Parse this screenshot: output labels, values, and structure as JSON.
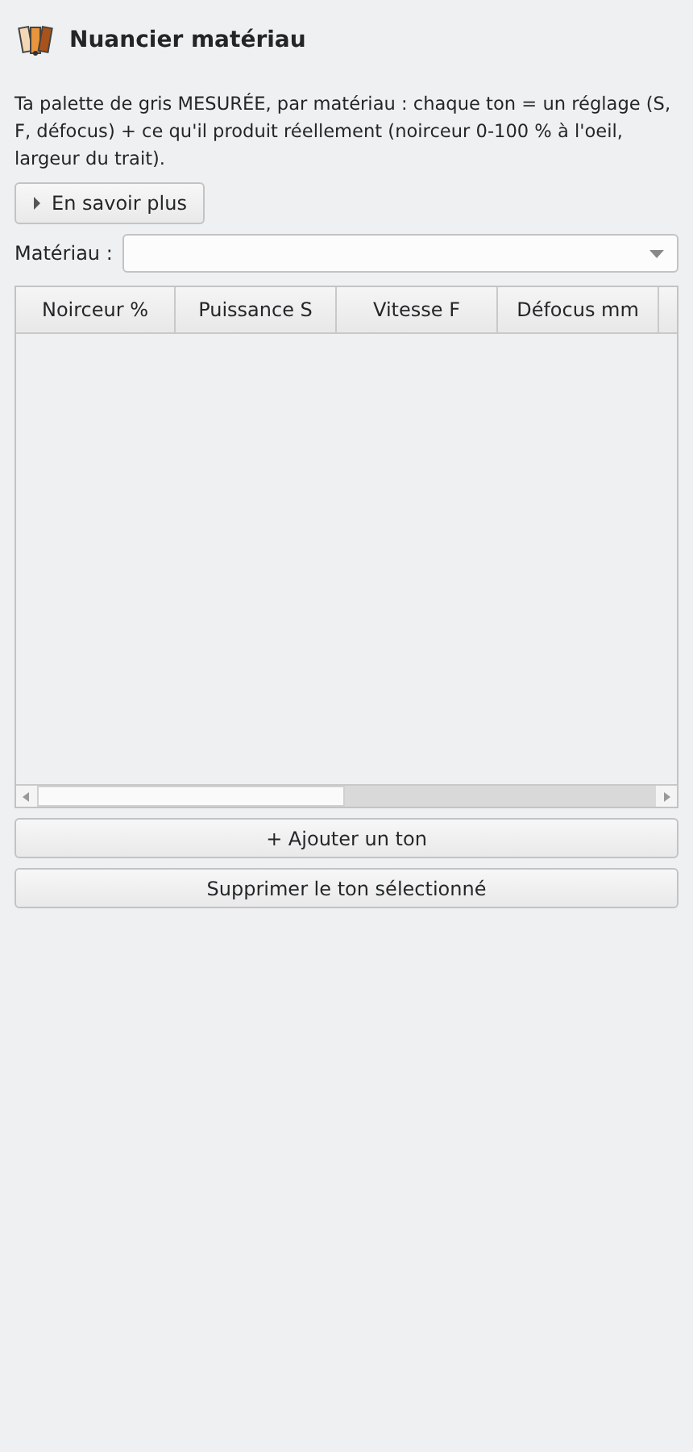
{
  "header": {
    "title": "Nuancier matériau"
  },
  "description": "Ta palette de gris MESURÉE, par matériau : chaque ton = un réglage (S, F, défocus) + ce qu'il produit réellement (noirceur 0-100 % à l'oeil, largeur du trait).",
  "more_info": {
    "label": "En savoir plus",
    "expanded": false
  },
  "material": {
    "label": "Matériau :"
  },
  "table": {
    "columns": [
      "Noirceur %",
      "Puissance S",
      "Vitesse F",
      "Défocus mm"
    ]
  },
  "buttons": [
    "+ Ajouter un ton",
    "Supprimer le ton sélectionné"
  ]
}
